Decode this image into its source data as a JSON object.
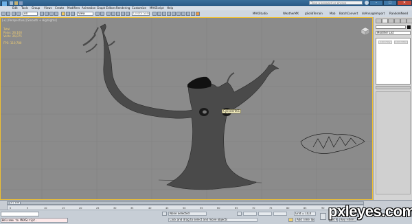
{
  "titlebar": {
    "search_placeholder": "Type a keyword or phrase",
    "minimize": "–",
    "maximize": "□",
    "close": "✕"
  },
  "menu": {
    "items": [
      "Edit",
      "Tools",
      "Group",
      "Views",
      "Create",
      "Modifiers",
      "Animation",
      "Graph Editors",
      "Rendering",
      "Customize",
      "MAXScript",
      "Help"
    ]
  },
  "toolbar": {
    "selection_filter": "All",
    "coordinate_system": "View",
    "named_selection_placeholder": "Create Selection Se",
    "tools_right": [
      "MAXStudio",
      "WeatherMX",
      "gSolidTerrain",
      "Mob",
      "BatchConvert",
      "dsAnnageImport",
      "RandomNeed"
    ]
  },
  "viewport": {
    "label": "[+] [Perspective] [Smooth + Highlights]",
    "stats": {
      "header": "Total",
      "polys_label": "Polys:",
      "polys_value": "26,160",
      "verts_label": "Verts:",
      "verts_value": "26,075",
      "fps_label": "FPS:",
      "fps_value": "110,780"
    },
    "tooltip": "Cylinder001"
  },
  "command_panel": {
    "modifier_list": "Modifier List",
    "mod_buttons": [
      "Edit Poly",
      "Edit Mesh"
    ]
  },
  "timeline": {
    "frame_counter": "0 / 100",
    "ticks": [
      "0",
      "5",
      "10",
      "15",
      "20",
      "25",
      "30",
      "35",
      "40",
      "45",
      "50",
      "55",
      "60",
      "65",
      "70",
      "75",
      "80",
      "85",
      "90",
      "95",
      "100"
    ]
  },
  "statusbar": {
    "maxscript_output": "Welcome to MAXScript.",
    "selection_status": "None Selected",
    "prompt": "Click and drag to select and move objects",
    "grid_value": "Grid = 10,0",
    "add_time_tag": "Add Time Tag",
    "auto_key": "Auto Key",
    "set_key": "Set Key",
    "selected": "Selected",
    "key_filters": "Key Filters..."
  },
  "watermark": "pxleyes.com",
  "colors": {
    "viewport_bg": "#8b8b8b",
    "active_border": "#f0c030",
    "stats": "#f5d070",
    "menubar": "#d7dee7",
    "titlebar": "#2a5a86"
  }
}
